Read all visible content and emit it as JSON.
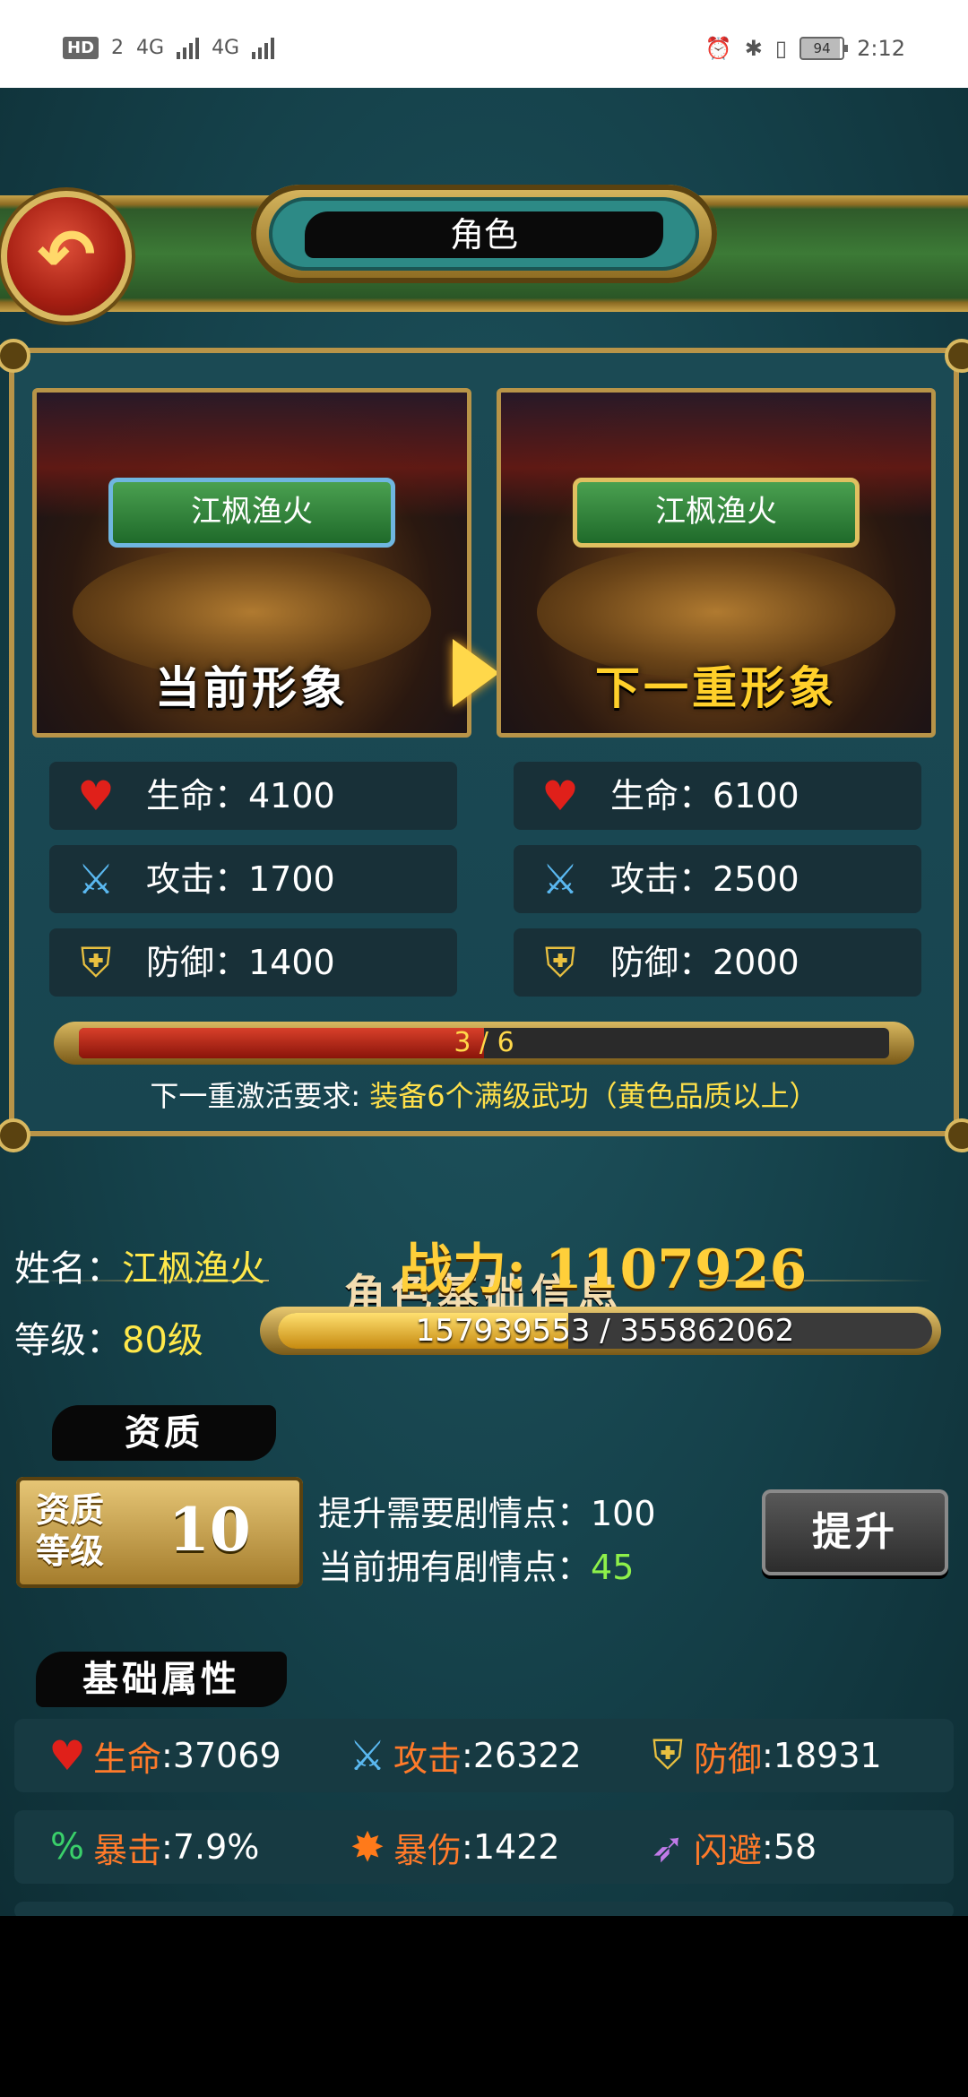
{
  "status_bar": {
    "time": "2:12",
    "battery": "94",
    "network_left": "HD",
    "sim": "2",
    "net1": "4G",
    "net2": "4G"
  },
  "header": {
    "title": "角色",
    "back_icon": "back-arrow-icon"
  },
  "compare": {
    "current": {
      "name": "江枫渔火",
      "caption": "当前形象",
      "stats": [
        {
          "icon": "heart-icon",
          "label": "生命：4100"
        },
        {
          "icon": "sword-icon",
          "label": "攻击：1700"
        },
        {
          "icon": "shield-icon",
          "label": "防御：1400"
        }
      ]
    },
    "next": {
      "name": "江枫渔火",
      "caption": "下一重形象",
      "stats": [
        {
          "icon": "heart-icon",
          "label": "生命：6100"
        },
        {
          "icon": "sword-icon",
          "label": "攻击：2500"
        },
        {
          "icon": "shield-icon",
          "label": "防御：2000"
        }
      ]
    },
    "progress": {
      "text": "3 / 6",
      "current": 3,
      "total": 6
    },
    "requirement": {
      "prefix": "下一重激活要求:",
      "detail": "装备6个满级武功（黄色品质以上）"
    }
  },
  "info": {
    "section_title": "角色基础信息",
    "name_label": "姓名：",
    "name_value": "江枫渔火",
    "power_label": "战力:",
    "power_value": "1107926",
    "level_label": "等级：",
    "level_value": "80级",
    "xp": {
      "text": "157939553 / 355862062",
      "current": 157939553,
      "total": 355862062
    }
  },
  "aptitude": {
    "title": "资质",
    "box_label": "资质等级",
    "box_value": "10",
    "need_text": "提升需要剧情点：100",
    "have_label": "当前拥有剧情点：",
    "have_value": "45",
    "upgrade_label": "提升"
  },
  "attributes": {
    "title": "基础属性",
    "rows": [
      [
        {
          "icon": "heart-icon",
          "name": "生命",
          "value": ":37069"
        },
        {
          "icon": "sword-icon",
          "name": "攻击",
          "value": ":26322"
        },
        {
          "icon": "shield-icon",
          "name": "防御",
          "value": ":18931"
        }
      ],
      [
        {
          "icon": "crit-icon",
          "name": "暴击",
          "value": ":7.9%"
        },
        {
          "icon": "burst-icon",
          "name": "暴伤",
          "value": ":1422"
        },
        {
          "icon": "dodge-icon",
          "name": "闪避",
          "value": ":58"
        }
      ]
    ]
  },
  "colors": {
    "accent_gold": "#ffd02a",
    "highlight_yellow": "#ffe04a",
    "attr_orange": "#ff7a2a",
    "green_value": "#8ef04a"
  }
}
